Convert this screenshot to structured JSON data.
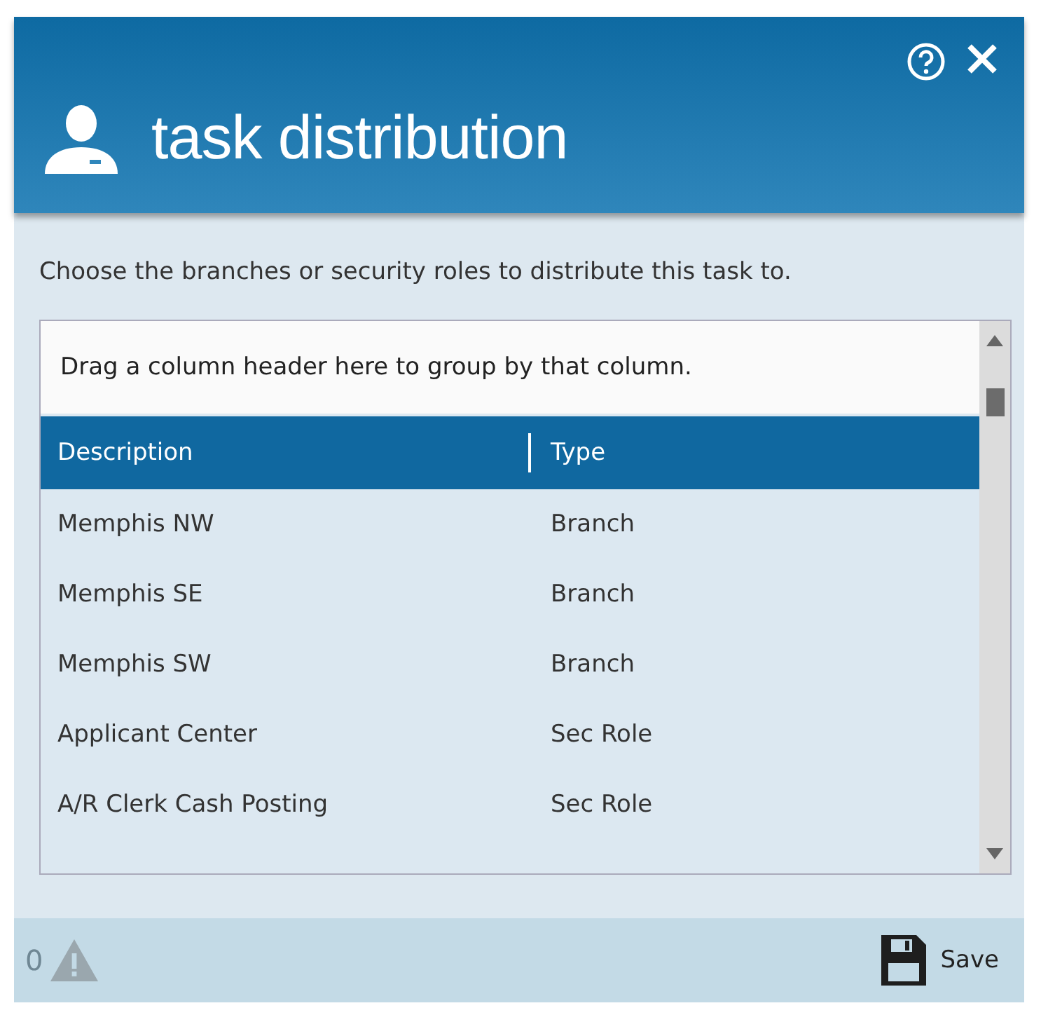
{
  "window": {
    "title": "task distribution"
  },
  "instructions": "Choose the branches or security roles to distribute this task to.",
  "grid": {
    "group_panel": "Drag a column header here to group by that column.",
    "columns": [
      "Description",
      "Type"
    ],
    "rows": [
      {
        "description": "Memphis NW",
        "type": "Branch"
      },
      {
        "description": "Memphis SE",
        "type": "Branch"
      },
      {
        "description": "Memphis SW",
        "type": "Branch"
      },
      {
        "description": "Applicant Center",
        "type": "Sec Role"
      },
      {
        "description": "A/R Clerk Cash Posting",
        "type": "Sec Role"
      }
    ]
  },
  "footer": {
    "warning_count": "0",
    "save_label": "Save"
  }
}
